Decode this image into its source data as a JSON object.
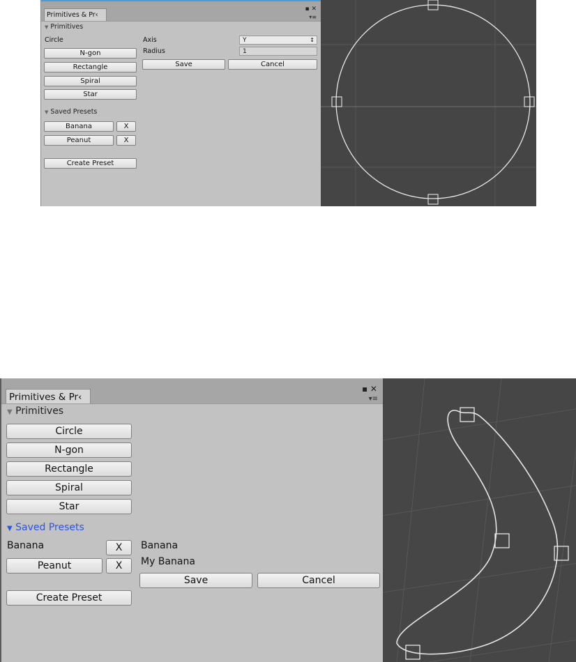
{
  "top": {
    "window": {
      "tab_label": "Primitives & Pr‹",
      "close_glyph": "▪ ✕",
      "menu_glyph": "▾≡"
    },
    "primitives_header": "Primitives",
    "primitive_selected": "Circle",
    "primitive_buttons": [
      "N-gon",
      "Rectangle",
      "Spiral",
      "Star"
    ],
    "saved_presets_header": "Saved Presets",
    "presets": [
      "Banana",
      "Peanut"
    ],
    "remove_label": "X",
    "create_preset_label": "Create Preset",
    "properties": {
      "axis_label": "Axis",
      "axis_value": "Y",
      "radius_label": "Radius",
      "radius_value": "1"
    },
    "save_label": "Save",
    "cancel_label": "Cancel"
  },
  "bottom": {
    "window": {
      "tab_label": "Primitives & Pr‹",
      "close_glyph": "▪ ✕",
      "menu_glyph": "▾≡"
    },
    "primitives_header": "Primitives",
    "primitive_buttons": [
      "Circle",
      "N-gon",
      "Rectangle",
      "Spiral",
      "Star"
    ],
    "saved_presets_header": "Saved Presets",
    "preset_selected": "Banana",
    "preset_other": "Peanut",
    "remove_label": "X",
    "create_preset_label": "Create Preset",
    "edit": {
      "original_name": "Banana",
      "new_name": "My Banana"
    },
    "save_label": "Save",
    "cancel_label": "Cancel"
  },
  "icons": {
    "foldout_open": "▼",
    "dropdown_arrows": "↕"
  },
  "colors": {
    "panel_bg": "#c2c2c2",
    "scene_bg": "#454545",
    "active_header": "#2b55e6",
    "focus_border": "#4a9bd6"
  }
}
